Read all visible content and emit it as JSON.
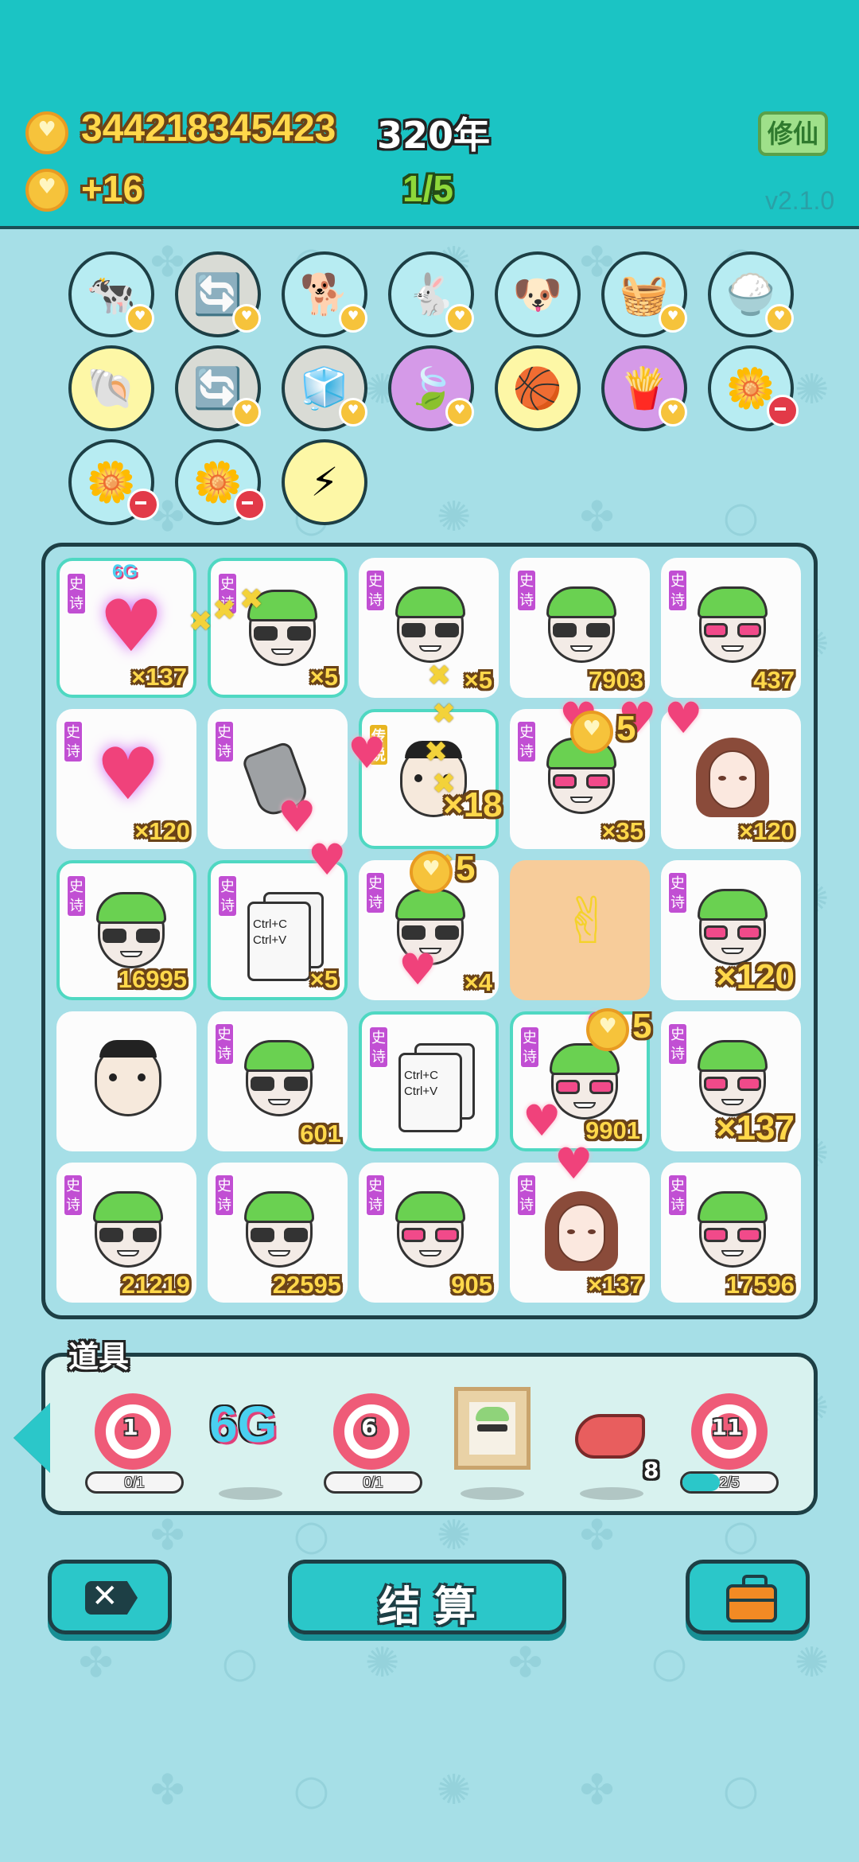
{
  "header": {
    "coins": "344218345423",
    "year": "320年",
    "income": "+16",
    "progress": "1/5",
    "mode_button": "修仙",
    "version": "v2.1.0"
  },
  "items": [
    {
      "icon": "cow-pair-icon",
      "glyph": "🐄",
      "bg": "#b7ecf2",
      "badge": "heart"
    },
    {
      "icon": "refresh-icon",
      "glyph": "🔄",
      "bg": "#d9dbd5",
      "badge": "heart"
    },
    {
      "icon": "husky-dog-icon",
      "glyph": "🐕",
      "bg": "#b7ecf2",
      "badge": "heart"
    },
    {
      "icon": "rabbit-icon",
      "glyph": "🐇",
      "bg": "#b7ecf2",
      "badge": "heart"
    },
    {
      "icon": "shiba-dog-icon",
      "glyph": "🐶",
      "bg": "#b7ecf2",
      "badge": "none"
    },
    {
      "icon": "fruit-basket-icon",
      "glyph": "🧺",
      "bg": "#b7ecf2",
      "badge": "heart"
    },
    {
      "icon": "rice-bowl-icon",
      "glyph": "🍚",
      "bg": "#b7ecf2",
      "badge": "heart"
    },
    {
      "icon": "shell-icon",
      "glyph": "🐚",
      "bg": "#fdf7a6",
      "badge": "none"
    },
    {
      "icon": "refresh-icon",
      "glyph": "🔄",
      "bg": "#d9dbd5",
      "badge": "heart"
    },
    {
      "icon": "sugar-cubes-icon",
      "glyph": "🧊",
      "bg": "#d9dbd5",
      "badge": "heart"
    },
    {
      "icon": "leaf-icon",
      "glyph": "🍃",
      "bg": "#d59ae8",
      "badge": "heart"
    },
    {
      "icon": "basketballs-icon",
      "glyph": "🏀",
      "bg": "#fdf7a6",
      "badge": "none"
    },
    {
      "icon": "fries-icon",
      "glyph": "🍟",
      "bg": "#d59ae8",
      "badge": "heart"
    },
    {
      "icon": "potted-flower-icon",
      "glyph": "🌼",
      "bg": "#b7ecf2",
      "badge": "minus"
    },
    {
      "icon": "potted-flower-icon",
      "glyph": "🌼",
      "bg": "#b7ecf2",
      "badge": "minus"
    },
    {
      "icon": "potted-flower-icon",
      "glyph": "🌼",
      "bg": "#b7ecf2",
      "badge": "minus"
    },
    {
      "icon": "lightning-icon",
      "glyph": "⚡",
      "bg": "#fdf7a6",
      "badge": "none"
    }
  ],
  "board": {
    "tag_epic": "史诗",
    "tag_legend": "传说",
    "cells": [
      {
        "kind": "heart",
        "tag": "epic",
        "count": "×137",
        "hl": true,
        "extra": "6G"
      },
      {
        "kind": "green",
        "tag": "epic",
        "count": "×5",
        "hl": true
      },
      {
        "kind": "green",
        "tag": "epic",
        "count": "×5"
      },
      {
        "kind": "green",
        "tag": "epic",
        "count": "7903"
      },
      {
        "kind": "green-pink",
        "tag": "epic",
        "count": "437"
      },
      {
        "kind": "heart",
        "tag": "epic",
        "count": "×120"
      },
      {
        "kind": "hand",
        "tag": "epic",
        "count": ""
      },
      {
        "kind": "face",
        "tag": "legend",
        "count": "",
        "hl": true
      },
      {
        "kind": "green-pink",
        "tag": "epic",
        "count": "×35"
      },
      {
        "kind": "girl",
        "tag": "",
        "count": "×120"
      },
      {
        "kind": "green",
        "tag": "epic",
        "count": "16995",
        "hl": true
      },
      {
        "kind": "ctrl",
        "tag": "epic",
        "count": "×5",
        "hl": true
      },
      {
        "kind": "green",
        "tag": "epic",
        "count": "×4"
      },
      {
        "kind": "rockhand",
        "tag": "",
        "count": "",
        "orange": true
      },
      {
        "kind": "green-pink",
        "tag": "epic",
        "count": "×120",
        "big": true
      },
      {
        "kind": "bald",
        "tag": "",
        "count": ""
      },
      {
        "kind": "green",
        "tag": "epic",
        "count": "601"
      },
      {
        "kind": "ctrl",
        "tag": "epic",
        "count": "",
        "hl": true
      },
      {
        "kind": "green-pink",
        "tag": "epic",
        "count": "9901",
        "hl": true
      },
      {
        "kind": "green-pink",
        "tag": "epic",
        "count": "×137",
        "big": true
      },
      {
        "kind": "green",
        "tag": "epic",
        "count": "21219"
      },
      {
        "kind": "green",
        "tag": "epic",
        "count": "22595"
      },
      {
        "kind": "green-pink",
        "tag": "epic",
        "count": "905"
      },
      {
        "kind": "girl",
        "tag": "epic",
        "count": "×137"
      },
      {
        "kind": "green-pink",
        "tag": "epic",
        "count": "17596"
      }
    ],
    "ctrl_text": "Ctrl+C\nCtrl+V",
    "effects": {
      "x18": "×18",
      "five_a": "5",
      "five_b": "5",
      "five_c": "5"
    }
  },
  "props": {
    "label": "道具",
    "t1": "1",
    "t1_bar": "0/1",
    "t1_fill": 0,
    "sixg": "6G",
    "t2": "6",
    "t2_bar": "0/1",
    "t2_fill": 0,
    "liver_count": "8",
    "t3": "11",
    "t3_bar": "2/5",
    "t3_fill": 0.4
  },
  "buttons": {
    "settle": "结 算"
  }
}
